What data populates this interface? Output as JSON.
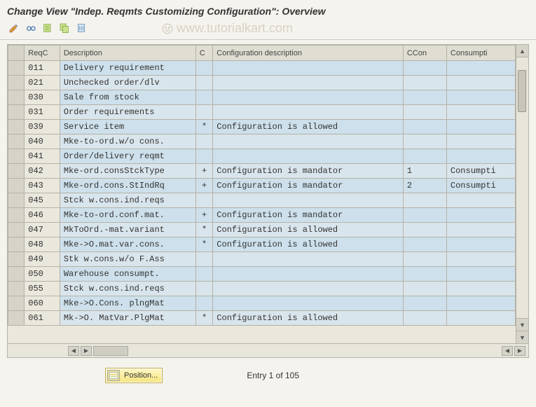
{
  "title": "Change View \"Indep. Reqmts Customizing Configuration\": Overview",
  "watermark": "www.tutorialkart.com",
  "toolbar": {
    "pencil_tip": "Display/Change",
    "glasses_tip": "Other View",
    "new_entries_tip": "New Entries",
    "copy_tip": "Copy As",
    "delete_tip": "Delete"
  },
  "columns": {
    "reqc": "ReqC",
    "desc": "Description",
    "cind": "C",
    "cdesc": "Configuration description",
    "ccon": "CCon",
    "consump": "Consumpti"
  },
  "rows": [
    {
      "reqc": "011",
      "desc": "Delivery requirement",
      "c": "",
      "cdesc": "",
      "ccon": "",
      "consump": ""
    },
    {
      "reqc": "021",
      "desc": "Unchecked order/dlv",
      "c": "",
      "cdesc": "",
      "ccon": "",
      "consump": ""
    },
    {
      "reqc": "030",
      "desc": "Sale from stock",
      "c": "",
      "cdesc": "",
      "ccon": "",
      "consump": ""
    },
    {
      "reqc": "031",
      "desc": "Order requirements",
      "c": "",
      "cdesc": "",
      "ccon": "",
      "consump": ""
    },
    {
      "reqc": "039",
      "desc": "Service item",
      "c": "*",
      "cdesc": "Configuration is allowed",
      "ccon": "",
      "consump": ""
    },
    {
      "reqc": "040",
      "desc": "Mke-to-ord.w/o cons.",
      "c": "",
      "cdesc": "",
      "ccon": "",
      "consump": ""
    },
    {
      "reqc": "041",
      "desc": "Order/delivery reqmt",
      "c": "",
      "cdesc": "",
      "ccon": "",
      "consump": ""
    },
    {
      "reqc": "042",
      "desc": "Mke-ord.consStckType",
      "c": "+",
      "cdesc": "Configuration is mandator",
      "ccon": "1",
      "consump": "Consumpti"
    },
    {
      "reqc": "043",
      "desc": "Mke-ord.cons.StIndRq",
      "c": "+",
      "cdesc": "Configuration is mandator",
      "ccon": "2",
      "consump": "Consumpti"
    },
    {
      "reqc": "045",
      "desc": "Stck w.cons.ind.reqs",
      "c": "",
      "cdesc": "",
      "ccon": "",
      "consump": ""
    },
    {
      "reqc": "046",
      "desc": "Mke-to-ord.conf.mat.",
      "c": "+",
      "cdesc": "Configuration is mandator",
      "ccon": "",
      "consump": ""
    },
    {
      "reqc": "047",
      "desc": "MkToOrd.-mat.variant",
      "c": "*",
      "cdesc": "Configuration is allowed",
      "ccon": "",
      "consump": ""
    },
    {
      "reqc": "048",
      "desc": "Mke->O.mat.var.cons.",
      "c": "*",
      "cdesc": "Configuration is allowed",
      "ccon": "",
      "consump": ""
    },
    {
      "reqc": "049",
      "desc": "Stk w.cons.w/o F.Ass",
      "c": "",
      "cdesc": "",
      "ccon": "",
      "consump": ""
    },
    {
      "reqc": "050",
      "desc": "Warehouse consumpt.",
      "c": "",
      "cdesc": "",
      "ccon": "",
      "consump": ""
    },
    {
      "reqc": "055",
      "desc": "Stck w.cons.ind.reqs",
      "c": "",
      "cdesc": "",
      "ccon": "",
      "consump": ""
    },
    {
      "reqc": "060",
      "desc": "Mke->O.Cons. plngMat",
      "c": "",
      "cdesc": "",
      "ccon": "",
      "consump": ""
    },
    {
      "reqc": "061",
      "desc": "Mk->O. MatVar.PlgMat",
      "c": "*",
      "cdesc": "Configuration is allowed",
      "ccon": "",
      "consump": ""
    }
  ],
  "footer": {
    "position_label": "Position...",
    "entry_text": "Entry 1 of 105"
  }
}
